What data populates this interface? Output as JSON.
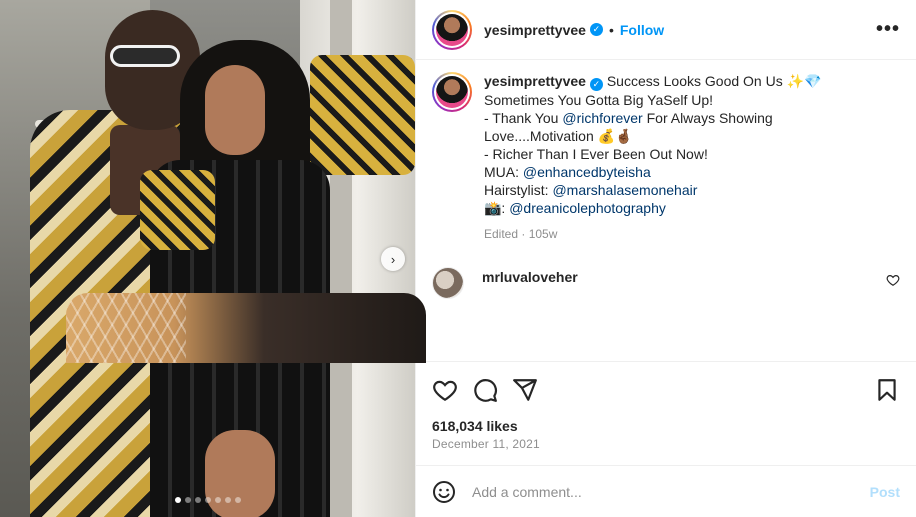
{
  "header": {
    "username": "yesimprettyvee",
    "separator": "•",
    "follow_label": "Follow",
    "more_icon": "more-horizontal-icon",
    "more_glyph": "•••"
  },
  "media": {
    "next_glyph": "›",
    "carousel_count": 7,
    "carousel_active": 0
  },
  "caption": {
    "username": "yesimprettyvee",
    "line1": "Success Looks Good On Us ✨💎",
    "line2": "Sometimes You Gotta Big YaSelf Up!",
    "line3_prefix": "- Thank You ",
    "line3_mention": "@richforever",
    "line3_suffix": " For Always Showing",
    "line4": "Love....Motivation 💰🤞🏾",
    "line5": "- Richer Than I Ever Been Out Now!",
    "line6_prefix": "MUA: ",
    "line6_mention": "@enhancedbyteisha",
    "line7_prefix": "Hairstylist: ",
    "line7_mention": "@marshalasemonehair",
    "line8_prefix": "📸: ",
    "line8_mention": "@dreanicolephotography",
    "meta": "Edited · 105w"
  },
  "comment": {
    "username": "mrluvaloveher"
  },
  "stats": {
    "likes": "618,034 likes",
    "date": "December 11, 2021"
  },
  "add_comment": {
    "placeholder": "Add a comment...",
    "post_label": "Post"
  },
  "colors": {
    "accent": "#0095f6",
    "mention": "#00376b",
    "muted": "#8e8e8e",
    "post_disabled": "#b2dffc"
  }
}
